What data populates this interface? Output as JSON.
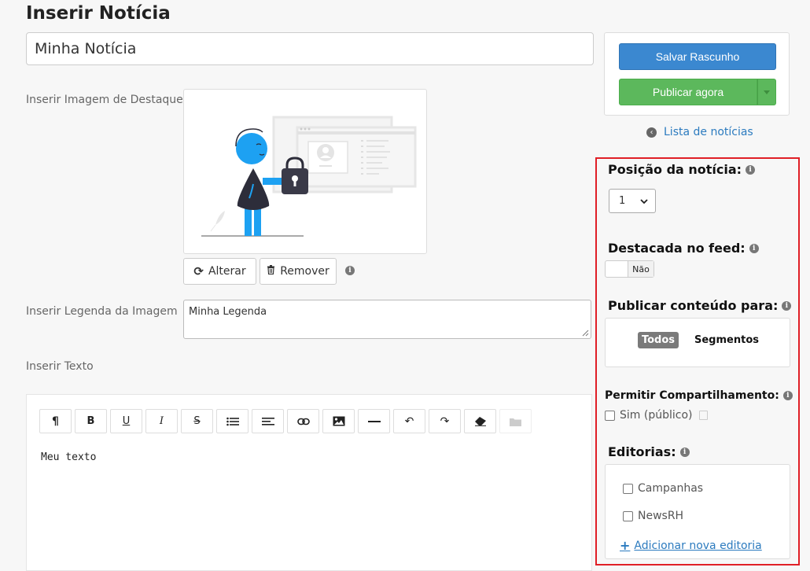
{
  "page": {
    "title": "Inserir Notícia"
  },
  "form": {
    "title_value": "Minha Notícia",
    "image_label": "Inserir Imagem de Destaque",
    "alter_label": "Alterar",
    "remove_label": "Remover",
    "caption_label": "Inserir Legenda da Imagem",
    "caption_value": "Minha Legenda",
    "text_label": "Inserir Texto",
    "editor_content": "Meu texto"
  },
  "toolbar": {
    "buttons": [
      {
        "icon": "paragraph-icon",
        "glyph": "¶"
      },
      {
        "icon": "bold-icon",
        "glyph": "B"
      },
      {
        "icon": "underline-icon",
        "glyph": "U"
      },
      {
        "icon": "italic-icon",
        "glyph": "I"
      },
      {
        "icon": "strikethrough-icon",
        "glyph": "S"
      },
      {
        "icon": "list-icon",
        "glyph": ""
      },
      {
        "icon": "align-icon",
        "glyph": ""
      },
      {
        "icon": "link-icon",
        "glyph": ""
      },
      {
        "icon": "image-icon",
        "glyph": ""
      },
      {
        "icon": "horizontal-rule-icon",
        "glyph": ""
      },
      {
        "icon": "undo-icon",
        "glyph": "↶"
      },
      {
        "icon": "redo-icon",
        "glyph": "↷"
      },
      {
        "icon": "eraser-icon",
        "glyph": ""
      },
      {
        "icon": "folder-icon",
        "glyph": ""
      }
    ]
  },
  "actions": {
    "save_draft": "Salvar Rascunho",
    "publish_now": "Publicar agora",
    "back_link": "Lista de notícias"
  },
  "settings": {
    "position_title": "Posição da notícia:",
    "position_value": "1",
    "featured_title": "Destacada no feed:",
    "featured_toggle": "Não",
    "audience_title": "Publicar conteúdo para:",
    "audience_all": "Todos",
    "audience_segments": "Segmentos",
    "share_title": "Permitir Compartilhamento:",
    "share_option": "Sim (público)",
    "editorias_title": "Editorias:",
    "editorias": [
      "Campanhas",
      "NewsRH"
    ],
    "add_editoria": "Adicionar nova editoria"
  },
  "colors": {
    "primary": "#3b88d0",
    "success": "#5cb85c",
    "highlight_border": "#e01f26",
    "link": "#2c7bbf",
    "illustration_accent": "#1da1f2"
  }
}
